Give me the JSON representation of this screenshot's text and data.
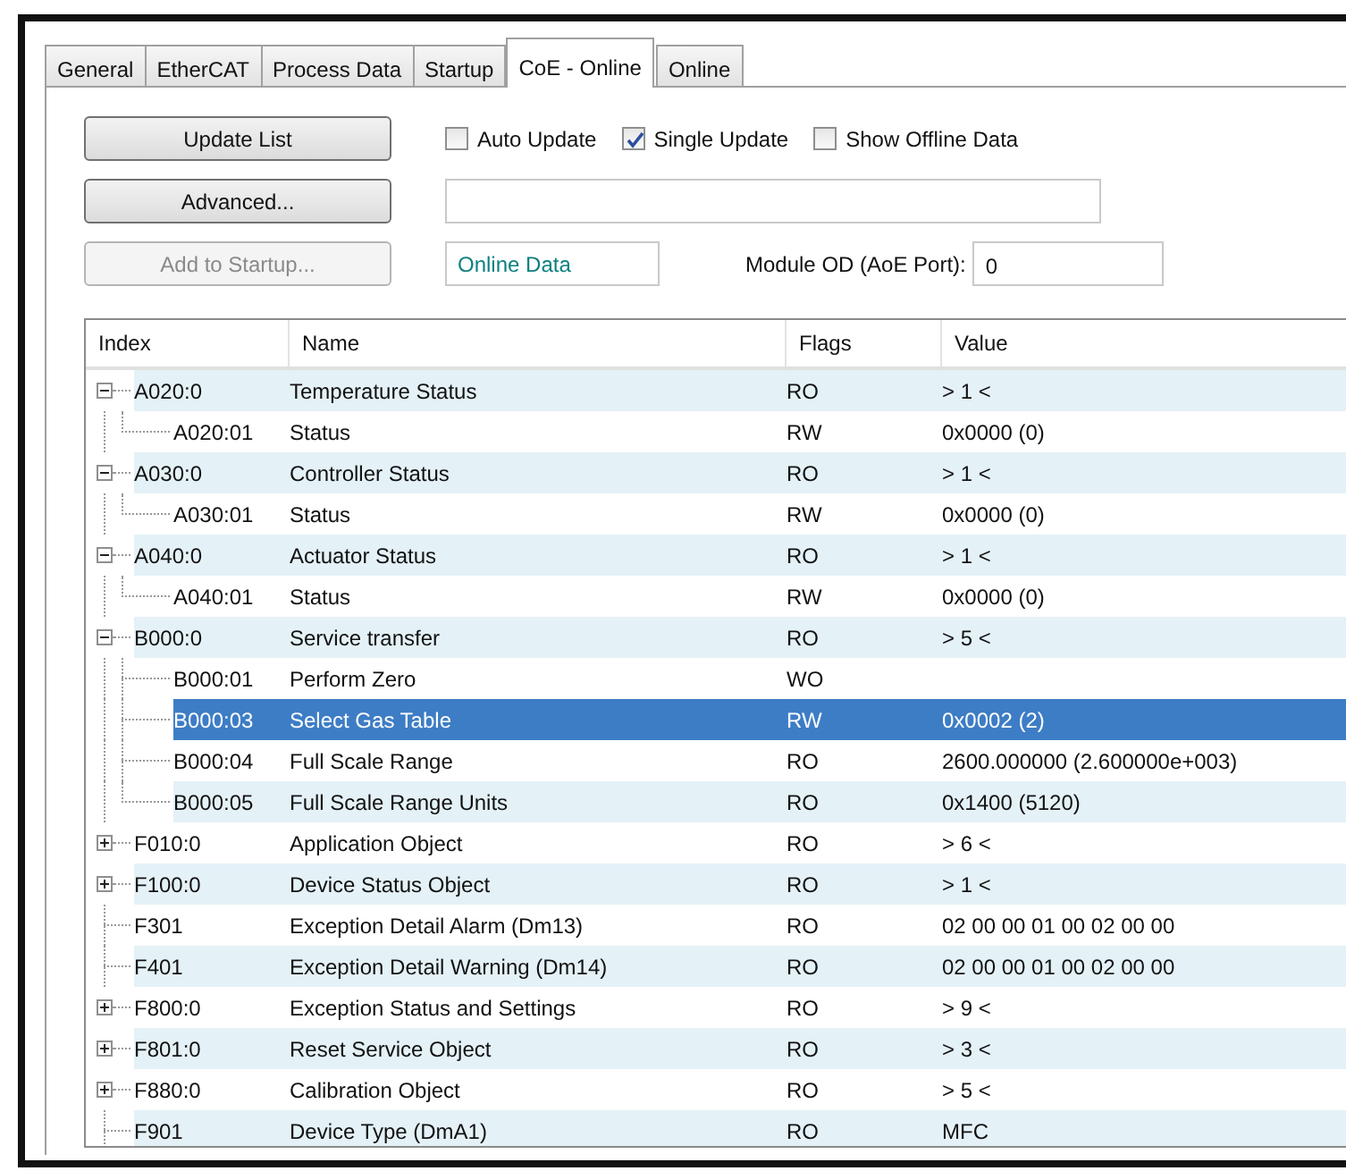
{
  "tabs": [
    {
      "label": "General",
      "selected": false
    },
    {
      "label": "EtherCAT",
      "selected": false
    },
    {
      "label": "Process Data",
      "selected": false
    },
    {
      "label": "Startup",
      "selected": false
    },
    {
      "label": "CoE - Online",
      "selected": true
    },
    {
      "label": "Online",
      "selected": false
    }
  ],
  "buttons": [
    {
      "label": "Update List",
      "disabled": false
    },
    {
      "label": "Advanced...",
      "disabled": false
    },
    {
      "label": "Add to Startup...",
      "disabled": true
    }
  ],
  "checkboxes": [
    {
      "label": "Auto Update",
      "checked": false
    },
    {
      "label": "Single Update",
      "checked": true
    },
    {
      "label": "Show Offline Data",
      "checked": false
    }
  ],
  "online_data_field": {
    "value": "Online Data"
  },
  "module_od": {
    "label": "Module OD (AoE Port):",
    "value": "0"
  },
  "table": {
    "columns": [
      "Index",
      "Name",
      "Flags",
      "Value"
    ],
    "rows": [
      {
        "index": "A020:0",
        "name": "Temperature Status",
        "flags": "RO",
        "value": "> 1 <",
        "kind": "group",
        "expanded": true,
        "selected": false,
        "children": [
          {
            "index": "A020:01",
            "name": "Status",
            "flags": "RW",
            "value": "0x0000 (0)",
            "kind": "leaf",
            "selected": false
          }
        ]
      },
      {
        "index": "A030:0",
        "name": "Controller Status",
        "flags": "RO",
        "value": "> 1 <",
        "kind": "group",
        "expanded": true,
        "selected": false,
        "children": [
          {
            "index": "A030:01",
            "name": "Status",
            "flags": "RW",
            "value": "0x0000 (0)",
            "kind": "leaf",
            "selected": false
          }
        ]
      },
      {
        "index": "A040:0",
        "name": "Actuator Status",
        "flags": "RO",
        "value": "> 1 <",
        "kind": "group",
        "expanded": true,
        "selected": false,
        "children": [
          {
            "index": "A040:01",
            "name": "Status",
            "flags": "RW",
            "value": "0x0000 (0)",
            "kind": "leaf",
            "selected": false
          }
        ]
      },
      {
        "index": "B000:0",
        "name": "Service transfer",
        "flags": "RO",
        "value": "> 5 <",
        "kind": "group",
        "expanded": true,
        "selected": false,
        "children": [
          {
            "index": "B000:01",
            "name": "Perform Zero",
            "flags": "WO",
            "kind": "leaf",
            "selected": false
          },
          {
            "index": "B000:03",
            "name": "Select Gas Table",
            "flags": "RW",
            "value": "0x0002 (2)",
            "kind": "leaf",
            "selected": true
          },
          {
            "index": "B000:04",
            "name": "Full Scale Range",
            "flags": "RO",
            "value": "2600.000000  (2.600000e+003)",
            "kind": "leaf",
            "selected": false
          },
          {
            "index": "B000:05",
            "name": "Full Scale Range Units",
            "flags": "RO",
            "value": "0x1400 (5120)",
            "kind": "leaf",
            "selected": false
          }
        ]
      },
      {
        "index": "F010:0",
        "name": "Application Object",
        "flags": "RO",
        "value": "> 6 <",
        "kind": "group",
        "expanded": false,
        "selected": false
      },
      {
        "index": "F100:0",
        "name": "Device Status Object",
        "flags": "RO",
        "value": "> 1 <",
        "kind": "group",
        "expanded": false,
        "selected": false
      },
      {
        "index": "F301",
        "name": "Exception Detail Alarm (Dm13)",
        "flags": "RO",
        "value": "02 00 00 01 00 02 00 00",
        "kind": "leaf",
        "selected": false
      },
      {
        "index": "F401",
        "name": "Exception Detail Warning (Dm14)",
        "flags": "RO",
        "value": "02 00 00 01 00 02 00 00",
        "kind": "leaf",
        "selected": false
      },
      {
        "index": "F800:0",
        "name": "Exception Status and Settings",
        "flags": "RO",
        "value": "> 9 <",
        "kind": "group",
        "expanded": false,
        "selected": false
      },
      {
        "index": "F801:0",
        "name": "Reset Service Object",
        "flags": "RO",
        "value": "> 3 <",
        "kind": "group",
        "expanded": false,
        "selected": false
      },
      {
        "index": "F880:0",
        "name": "Calibration Object",
        "flags": "RO",
        "value": "> 5 <",
        "kind": "group",
        "expanded": false,
        "selected": false
      },
      {
        "index": "F901",
        "name": "Device Type (DmA1)",
        "flags": "RO",
        "value": "MFC",
        "kind": "leaf",
        "selected": false
      }
    ]
  }
}
